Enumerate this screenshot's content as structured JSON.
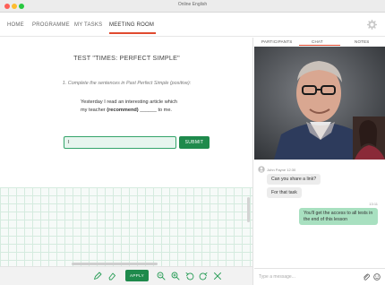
{
  "window": {
    "title": "Online English"
  },
  "nav": {
    "items": [
      {
        "label": "HOME"
      },
      {
        "label": "PROGRAMME"
      },
      {
        "label": "MY TASKS"
      },
      {
        "label": "MEETING ROOM",
        "active": true
      }
    ],
    "settings_icon": "gear-icon"
  },
  "test": {
    "title": "TEST \"TIMES: PERFECT SIMPLE\"",
    "instruction": "1. Complete the sentences in Past Perfect Simple (positive):",
    "sentence_part1": "Yesterday I read an interesting article which",
    "sentence_part2": "my teacher ",
    "sentence_keyword": "(recommend)",
    "sentence_part3": " ______ to me.",
    "answer_value": "I",
    "submit_label": "SUBMIT"
  },
  "toolbar": {
    "apply_label": "APPLY",
    "tools": [
      "pencil-icon",
      "eraser-icon",
      "zoom-out-icon",
      "zoom-in-icon",
      "undo-icon",
      "redo-icon",
      "close-icon"
    ]
  },
  "panel": {
    "tabs": [
      {
        "label": "PARTICIPANTS"
      },
      {
        "label": "CHAT",
        "active": true
      },
      {
        "label": "NOTES"
      }
    ]
  },
  "chat": {
    "sender_line": "John Payne 12:30",
    "messages_in": [
      "Can you share a link?",
      "For that task"
    ],
    "time_out": "13:11",
    "message_out": "You'll get the access to all tests in the end of this lesson",
    "placeholder": "Type a message..."
  },
  "colors": {
    "accent": "#e04a2f",
    "green": "#1f8a4c",
    "bubble_out": "#a8e0c0"
  }
}
